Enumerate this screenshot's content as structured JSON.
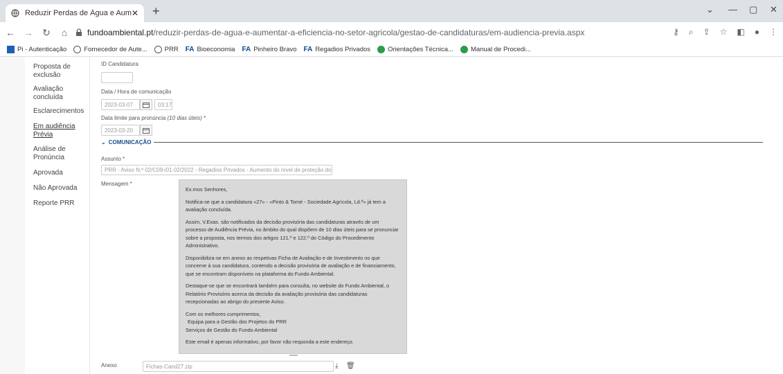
{
  "browser": {
    "tab_title": "Reduzir Perdas de Água e Aumen",
    "url_host": "fundoambiental.pt",
    "url_path": "/reduzir-perdas-de-agua-e-aumentar-a-eficiencia-no-setor-agricola/gestao-de-candidaturas/em-audiencia-previa.aspx",
    "bookmarks": [
      {
        "label": "Pi - Autenticação",
        "icon": "pi-icon"
      },
      {
        "label": "Fornecedor de Aute...",
        "icon": "globe-icon"
      },
      {
        "label": "PRR",
        "icon": "globe-icon"
      },
      {
        "label": "Bioeconomia",
        "icon": "fa-icon"
      },
      {
        "label": "Pinheiro Bravo",
        "icon": "fa-icon"
      },
      {
        "label": "Regadios Privados",
        "icon": "fa-icon"
      },
      {
        "label": "Orientações Técnica...",
        "icon": "green-circle-icon"
      },
      {
        "label": "Manual de Procedi...",
        "icon": "green-circle-icon"
      }
    ],
    "fa_text": "FA"
  },
  "sidebar": {
    "items": [
      {
        "label": "Proposta de exclusão"
      },
      {
        "label": "Avaliação concluída"
      },
      {
        "label": "Esclarecimentos"
      },
      {
        "label": "Em audiência Prévia"
      },
      {
        "label": "Análise de Pronúncia"
      },
      {
        "label": "Aprovada"
      },
      {
        "label": "Não Aprovada"
      },
      {
        "label": "Reporte PRR"
      }
    ]
  },
  "form": {
    "id_label": "ID Candidatura",
    "id_value": "",
    "comm_label": "Data / Hora de comunicação",
    "comm_date": "2023-03-07",
    "comm_time": "03:17",
    "limit_label": "Data limite para pronúncia",
    "limit_hint": "(10 dias úteis)",
    "limit_req": " *",
    "limit_date": "2023-03-20",
    "section_title": "COMUNICAÇÃO",
    "subject_label": "Assunto *",
    "subject_value": "PRR - Aviso N.º 02/C09-i01.02/2022 - Regadios Privados - Aumento do nível de proteção do ambier",
    "message_label": "Mensagem *",
    "message_paragraphs": [
      "Ex.mos Senhores,",
      "Notifica-se que a candidatura «27» - «Pinto & Tomé - Sociedade Agrícola, Ld.ª» já tem a avaliação concluída.",
      "Assim, V.Exas. são notificados da decisão provisória das candidaturas através de um processo de Audiência Prévia, no âmbito do qual dispõem de 10 dias úteis para se pronunciar sobre a proposta, nos termos dos artigos 121.º e 122.º do Código do Procedimento Administrativo.",
      "Disponibiliza-se em anexo as respetivas Ficha de Avaliação e de Investimento no que concerne à sua candidatura, contendo a decisão provisória de avaliação e de financiamento, que se encontram disponíveis na plataforma do Fundo Ambiental.",
      "Destaque-se que se encontrará também para consulta, no website do Fundo Ambiental, o Relatório Provisório acerca da decisão da avaliação provisória das candidaturas recepcionadas ao abrigo do presente Aviso.",
      "Com os melhores cumprimentos,",
      "Este email é apenas informativo, por favor não responda a este endereço."
    ],
    "signature_line1": "Equipa para a Gestão dos Projetos do PRR",
    "signature_line2": "Serviços de Gestão do Fundo Ambiental",
    "attachment_label": "Anexo",
    "attachment_value": "Fichas-Cand27.zip"
  }
}
